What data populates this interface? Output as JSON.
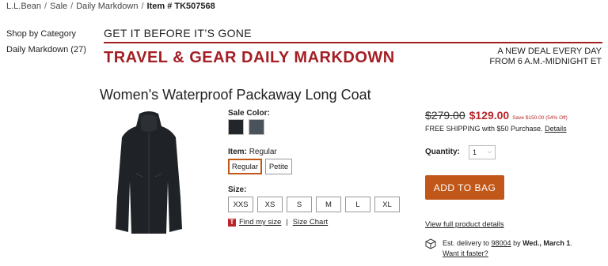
{
  "breadcrumb": {
    "items": [
      "L.L.Bean",
      "Sale",
      "Daily Markdown"
    ],
    "item_prefix": "Item # ",
    "item_number": "TK507568"
  },
  "sidebar": {
    "items": [
      {
        "label": "Shop by Category"
      },
      {
        "label": "Daily Markdown (27)"
      }
    ]
  },
  "banner": {
    "tagline": "GET IT BEFORE IT’S GONE",
    "title": "TRAVEL & GEAR DAILY MARKDOWN",
    "right_line1": "A NEW DEAL EVERY DAY",
    "right_line2": "FROM 6 A.M.-MIDNIGHT ET",
    "accent_color": "#a31f24"
  },
  "product": {
    "title": "Women's Waterproof Packaway Long Coat",
    "color_label": "Sale Color:",
    "swatches": [
      {
        "name": "black",
        "color": "#22262b"
      },
      {
        "name": "charcoal",
        "color": "#4a525a"
      }
    ],
    "item_label": "Item:",
    "item_value": "Regular",
    "item_options": [
      "Regular",
      "Petite"
    ],
    "item_selected": "Regular",
    "size_label": "Size:",
    "sizes": [
      "XXS",
      "XS",
      "S",
      "M",
      "L",
      "XL"
    ],
    "find_size": "Find my size",
    "size_chart": "Size Chart"
  },
  "pricing": {
    "original": "$279.00",
    "sale": "$129.00",
    "savings": "Save $150.00 (54% Off)",
    "shipping": "FREE SHIPPING with $50 Purchase.",
    "shipping_details": "Details",
    "qty_label": "Quantity:",
    "qty_value": "1",
    "add_to_bag": "ADD TO BAG",
    "button_color": "#c2571a",
    "view_details": "View full product details",
    "delivery_prefix": "Est. delivery to ",
    "delivery_zip": "98004",
    "delivery_by": " by ",
    "delivery_date": "Wed., March 1",
    "delivery_end": ".",
    "faster": "Want it faster?"
  }
}
